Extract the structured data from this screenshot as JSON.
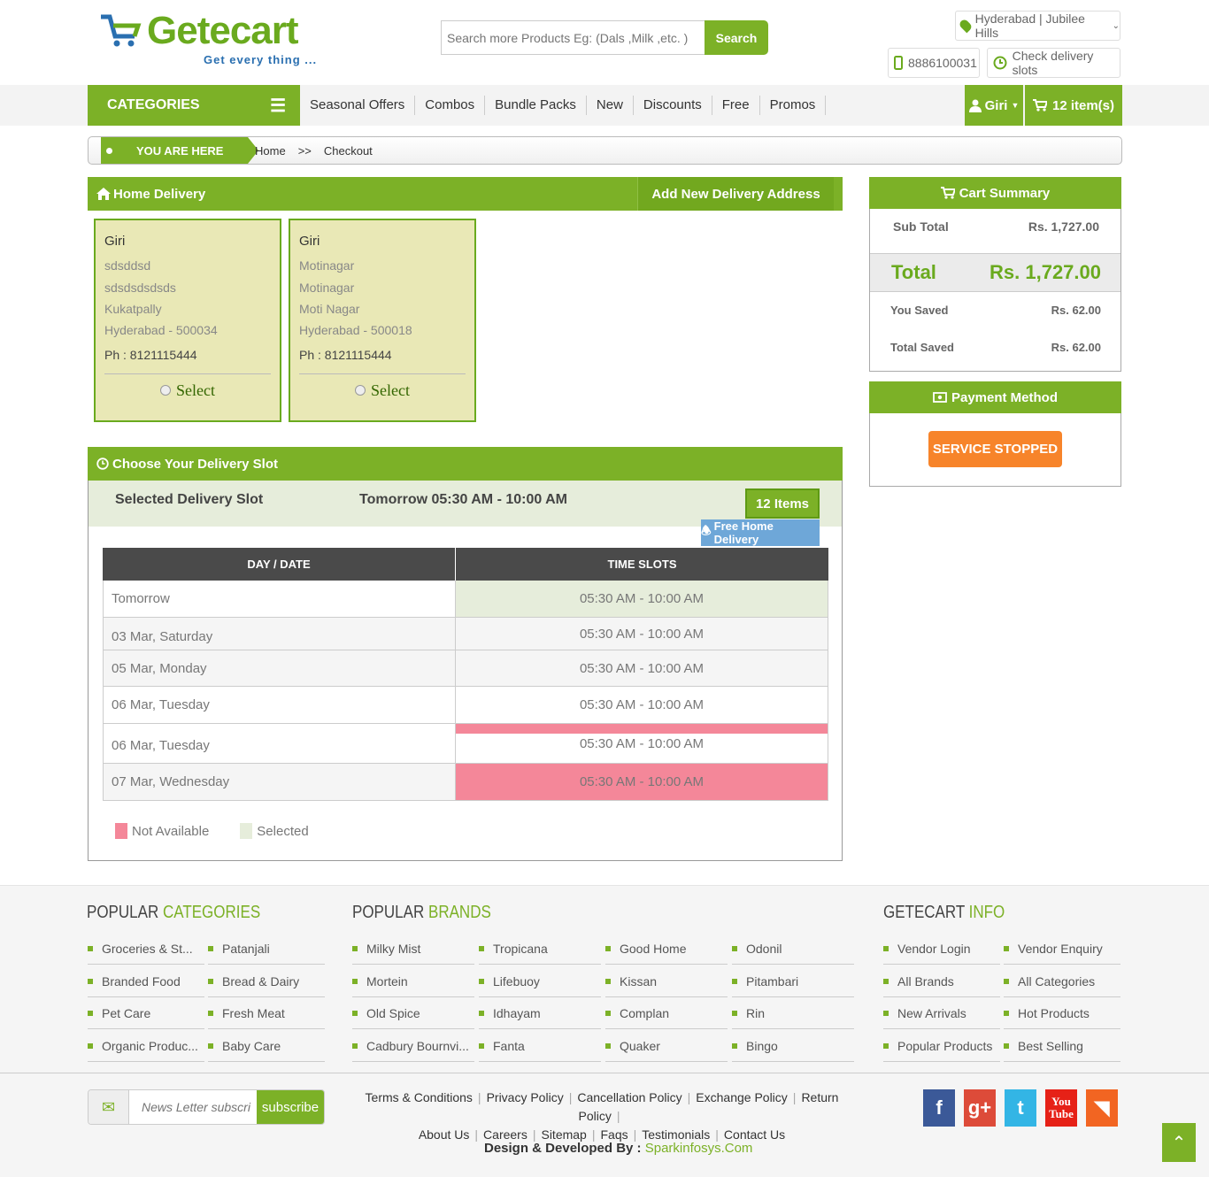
{
  "header": {
    "logo_text": "Getecart",
    "logo_tagline": "Get every thing ...",
    "search_placeholder": "Search more Products Eg: (Dals ,Milk ,etc. )",
    "search_button": "Search",
    "location": "Hyderabad | Jubilee Hills",
    "phone": "8886100031",
    "check_slots": "Check delivery slots"
  },
  "nav": {
    "categories": "CATEGORIES",
    "items": [
      "Seasonal Offers",
      "Combos",
      "Bundle Packs",
      "New",
      "Discounts",
      "Free",
      "Promos"
    ],
    "user": "Giri",
    "cart": "12 item(s)"
  },
  "breadcrumb": {
    "tag": "YOU ARE HERE",
    "home": "Home",
    "sep": ">>",
    "current": "Checkout"
  },
  "home_delivery": {
    "title": "Home Delivery",
    "add_button": "Add New Delivery Address",
    "addresses": [
      {
        "name": "Giri",
        "line1": "sdsddsd",
        "line2": "sdsdsdsdsds",
        "line3": "Kukatpally",
        "city": "Hyderabad - 500034",
        "phone": "Ph : 8121115444",
        "select": "Select"
      },
      {
        "name": "Giri",
        "line1": "Motinagar",
        "line2": "Motinagar",
        "line3": "Moti Nagar",
        "city": "Hyderabad - 500018",
        "phone": "Ph : 8121115444",
        "select": "Select"
      }
    ]
  },
  "delivery_slot": {
    "title": "Choose Your Delivery Slot",
    "selected_label": "Selected Delivery Slot",
    "selected_value": "Tomorrow 05:30 AM - 10:00 AM",
    "items_button": "12 Items",
    "free_delivery": "Free Home Delivery",
    "col_day": "DAY / DATE",
    "col_time": "TIME SLOTS",
    "rows": [
      {
        "day": "Tomorrow",
        "time": "05:30 AM - 10:00 AM"
      },
      {
        "day": "03 Mar, Saturday",
        "time": "05:30 AM - 10:00 AM"
      },
      {
        "day": "05 Mar, Monday",
        "time": "05:30 AM - 10:00 AM"
      },
      {
        "day": "06 Mar, Tuesday",
        "time": "05:30 AM - 10:00 AM"
      },
      {
        "day": "06 Mar, Tuesday",
        "time": "05:30 AM - 10:00 AM"
      },
      {
        "day": "07 Mar, Wednesday",
        "time": "05:30 AM - 10:00 AM"
      }
    ],
    "legend_na": "Not Available",
    "legend_sel": "Selected",
    "color_na": "#f48799",
    "color_sel": "#e6eddb"
  },
  "cart_summary": {
    "title": "Cart Summary",
    "subtotal_label": "Sub Total",
    "subtotal_value": "Rs. 1,727.00",
    "total_label": "Total",
    "total_value": "Rs. 1,727.00",
    "saved_label": "You Saved",
    "saved_value": "Rs. 62.00",
    "total_saved_label": "Total Saved",
    "total_saved_value": "Rs. 62.00"
  },
  "payment": {
    "title": "Payment Method",
    "button": "SERVICE STOPPED"
  },
  "footer": {
    "cat_head_a": "POPULAR ",
    "cat_head_b": "CATEGORIES",
    "brand_head_a": "POPULAR ",
    "brand_head_b": "BRANDS",
    "info_head_a": "GETECART ",
    "info_head_b": "INFO",
    "categories": [
      "Groceries & St...",
      "Patanjali",
      "Branded Food",
      "Bread & Dairy",
      "Pet Care",
      "Fresh Meat",
      "Organic Produc...",
      "Baby Care"
    ],
    "brands": [
      "Milky Mist",
      "Tropicana",
      "Good Home",
      "Odonil",
      "Mortein",
      "Lifebuoy",
      "Kissan",
      "Pitambari",
      "Old Spice",
      "Idhayam",
      "Complan",
      "Rin",
      "Cadbury Bournvi...",
      "Fanta",
      "Quaker",
      "Bingo"
    ],
    "info": [
      "Vendor Login",
      "Vendor Enquiry",
      "All Brands",
      "All Categories",
      "New Arrivals",
      "Hot Products",
      "Popular Products",
      "Best Selling"
    ],
    "newsletter_placeholder": "News Letter subscri",
    "subscribe": "subscribe",
    "policies_row1": [
      "Terms & Conditions",
      "Privacy Policy",
      "Cancellation Policy",
      "Exchange Policy",
      "Return Policy"
    ],
    "policies_row2": [
      "About Us",
      "Careers",
      "Sitemap",
      "Faqs",
      "Testimonials",
      "Contact Us"
    ],
    "credit_label": "Design & Developed By : ",
    "credit_link": "Sparkinfosys.Com",
    "social": [
      {
        "name": "facebook-icon",
        "glyph": "f",
        "color": "#3b5998"
      },
      {
        "name": "google-plus-icon",
        "glyph": "g+",
        "color": "#dd4b39"
      },
      {
        "name": "twitter-icon",
        "glyph": "t",
        "color": "#33b5e5"
      },
      {
        "name": "youtube-icon",
        "glyph": "You Tube",
        "color": "#e62117"
      },
      {
        "name": "rss-icon",
        "glyph": "◥",
        "color": "#f26522"
      }
    ]
  }
}
